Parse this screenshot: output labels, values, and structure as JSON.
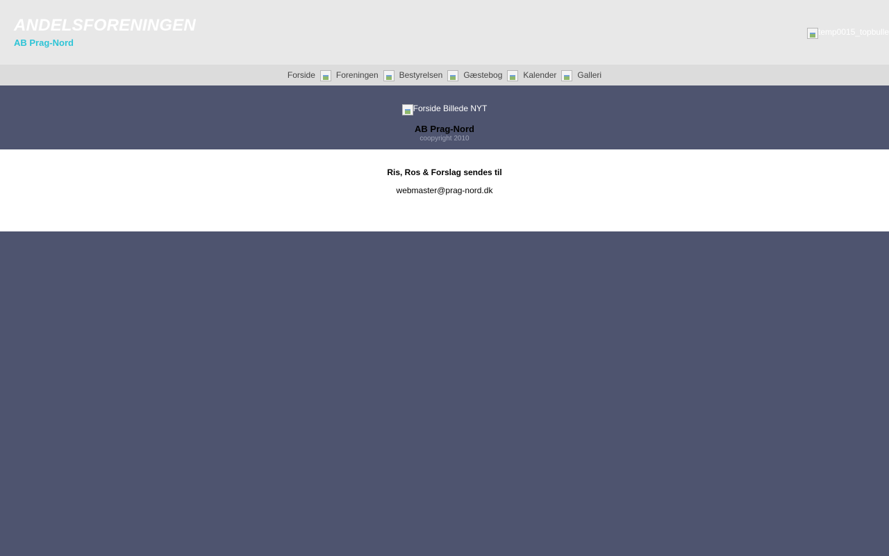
{
  "header": {
    "title": "ANDELSFORENINGEN",
    "subtitle": "AB Prag-Nord",
    "image_alt": "temp0015_topbulle"
  },
  "nav": {
    "items": [
      "Forside",
      "Foreningen",
      "Bestyrelsen",
      "Gæstebog",
      "Kalender",
      "Galleri"
    ],
    "separator_icon": "broken-image-icon"
  },
  "hero": {
    "image_alt": "Forside Billede NYT",
    "title": "AB Prag-Nord",
    "copyright": "coopyright 2010"
  },
  "content": {
    "heading": "Ris, Ros & Forslag sendes til",
    "email": "webmaster@prag-nord.dk"
  },
  "colors": {
    "header_bg": "#e8e8e8",
    "nav_bg": "#dcdcdc",
    "dark_bg": "#4e546f",
    "subtitle": "#2ec4d6"
  }
}
